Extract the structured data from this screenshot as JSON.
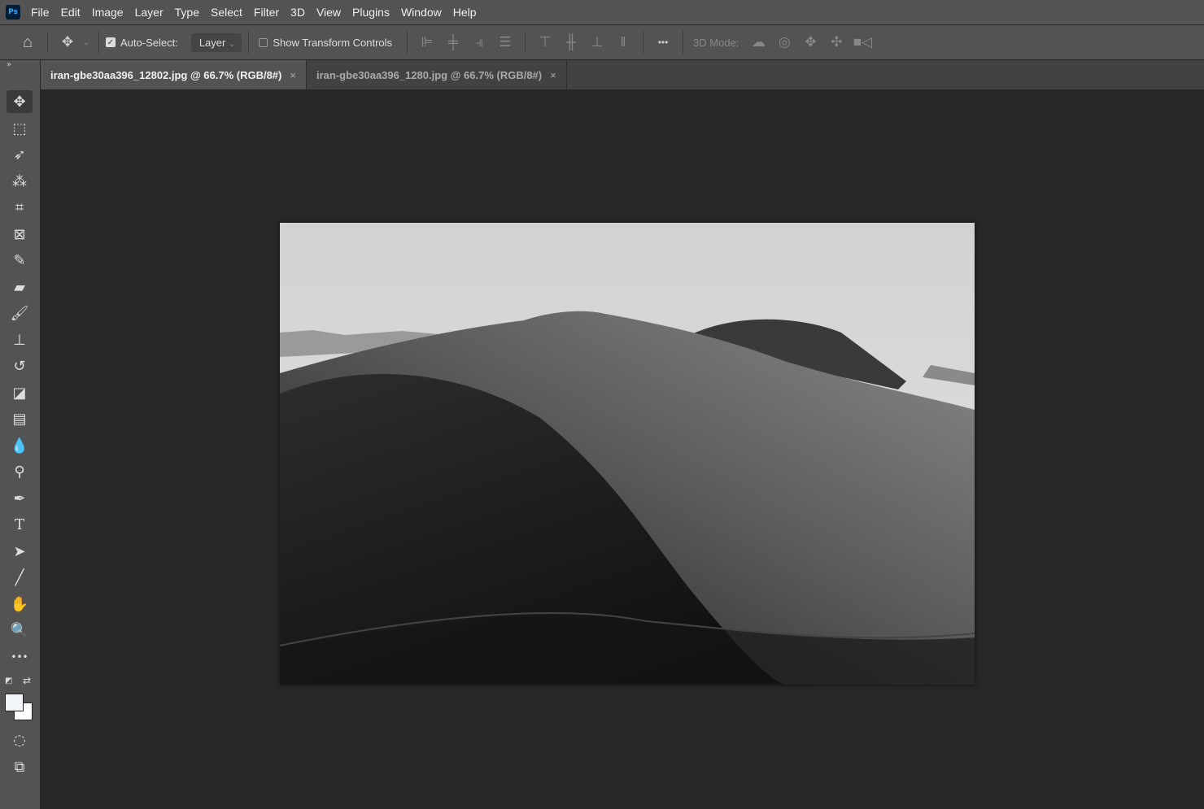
{
  "app": {
    "logo": "Ps"
  },
  "menu": [
    "File",
    "Edit",
    "Image",
    "Layer",
    "Type",
    "Select",
    "Filter",
    "3D",
    "View",
    "Plugins",
    "Window",
    "Help"
  ],
  "options": {
    "auto_select_label": "Auto-Select:",
    "auto_select_checked": true,
    "auto_select_value": "Layer",
    "show_transform_label": "Show Transform Controls",
    "show_transform_checked": false,
    "mode_3d_label": "3D Mode:",
    "more": "•••"
  },
  "tabs": [
    {
      "label": "iran-gbe30aa396_12802.jpg @ 66.7% (RGB/8#)",
      "active": true
    },
    {
      "label": "iran-gbe30aa396_1280.jpg @ 66.7% (RGB/8#)",
      "active": false
    }
  ],
  "tools": [
    "move",
    "marquee",
    "lasso",
    "magic-wand",
    "crop",
    "frame",
    "eyedropper",
    "healing",
    "brush",
    "stamp",
    "history-brush",
    "eraser",
    "gradient",
    "blur",
    "dodge",
    "pen",
    "type",
    "path-selection",
    "line",
    "hand",
    "zoom",
    "more"
  ],
  "colors": {
    "foreground": "#f2f5fa",
    "background": "#ffffff"
  }
}
